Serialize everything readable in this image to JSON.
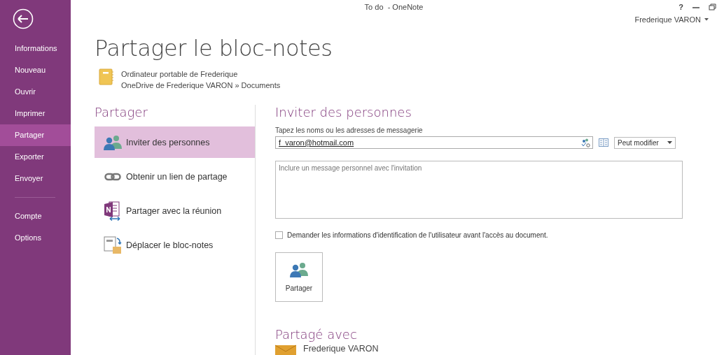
{
  "window": {
    "title": "To do  - OneNote",
    "controls": [
      "?"
    ],
    "user": "Frederique VARON"
  },
  "sidebar": {
    "items": [
      {
        "label": "Informations",
        "selected": false
      },
      {
        "label": "Nouveau",
        "selected": false
      },
      {
        "label": "Ouvrir",
        "selected": false
      },
      {
        "label": "Imprimer",
        "selected": false
      },
      {
        "label": "Partager",
        "selected": true
      },
      {
        "label": "Exporter",
        "selected": false
      },
      {
        "label": "Envoyer",
        "selected": false
      },
      {
        "label": "Compte",
        "selected": false,
        "divider_before": true
      },
      {
        "label": "Options",
        "selected": false
      }
    ]
  },
  "page": {
    "title": "Partager le bloc-notes",
    "notebook": {
      "name": "Ordinateur portable de Frederique",
      "location": "OneDrive de Frederique VARON » Documents"
    }
  },
  "share": {
    "heading": "Partager",
    "options": [
      {
        "label": "Inviter des personnes",
        "kind": "people",
        "selected": true
      },
      {
        "label": "Obtenir un lien de partage",
        "kind": "link",
        "selected": false
      },
      {
        "label": "Partager avec la réunion",
        "kind": "meeting",
        "selected": false
      },
      {
        "label": "Déplacer le bloc-notes",
        "kind": "move",
        "selected": false
      }
    ]
  },
  "invite": {
    "heading": "Inviter des personnes",
    "names_label": "Tapez les noms ou les adresses de messagerie",
    "names_value": "f_varon@hotmail.com",
    "permission": "Peut modifier",
    "message_placeholder": "Inclure un message personnel avec l'invitation",
    "require_signin": {
      "label": "Demander les informations d'identification de l'utilisateur avant l'accès au document.",
      "checked": false
    },
    "share_button": "Partager"
  },
  "shared_with": {
    "heading": "Partagé avec",
    "people": [
      {
        "name": "Frederique VARON"
      }
    ]
  }
}
